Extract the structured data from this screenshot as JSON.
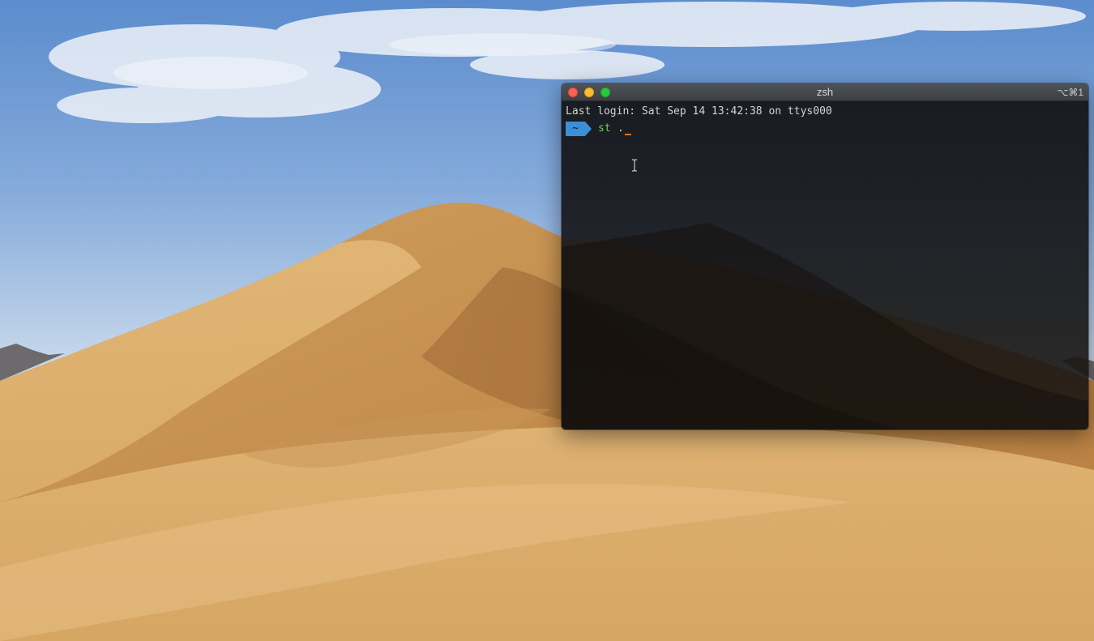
{
  "terminal": {
    "title": "zsh",
    "shortcut": "⌥⌘1",
    "login_line": "Last login: Sat Sep 14 13:42:38 on ttys000",
    "prompt_dir": "~",
    "command": "st",
    "command_arg": "."
  },
  "colors": {
    "prompt_badge": "#3b8fd6",
    "command": "#6fcf5c",
    "cursor": "#e8701c"
  },
  "icons": {
    "close": "close-icon",
    "minimize": "minimize-icon",
    "maximize": "maximize-icon",
    "text_cursor": "ibeam-cursor-icon"
  }
}
